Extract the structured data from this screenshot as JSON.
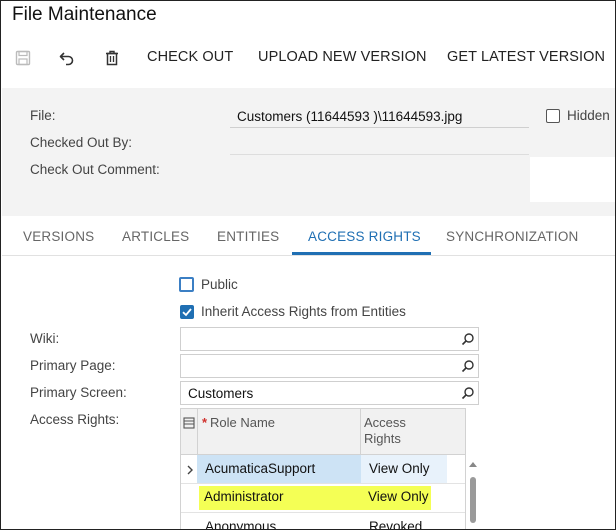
{
  "window": {
    "title": "File Maintenance"
  },
  "toolbar": {
    "save_icon": "save-icon",
    "undo_icon": "undo-icon",
    "delete_icon": "trash-icon",
    "check_out": "CHECK OUT",
    "upload_new_version": "UPLOAD NEW VERSION",
    "get_latest_version": "GET LATEST VERSION"
  },
  "form": {
    "file_label": "File:",
    "file_value": "Customers (11644593  )\\11644593.jpg",
    "hidden_label": "Hidden",
    "hidden_checked": false,
    "checked_out_by_label": "Checked Out By:",
    "checked_out_by_value": "",
    "check_out_comment_label": "Check Out Comment:",
    "check_out_comment_value": ""
  },
  "tabs": [
    {
      "label": "VERSIONS",
      "active": false
    },
    {
      "label": "ARTICLES",
      "active": false
    },
    {
      "label": "ENTITIES",
      "active": false
    },
    {
      "label": "ACCESS RIGHTS",
      "active": true
    },
    {
      "label": "SYNCHRONIZATION",
      "active": false
    }
  ],
  "access": {
    "public_label": "Public",
    "public_checked": false,
    "inherit_label": "Inherit Access Rights from Entities",
    "inherit_checked": true,
    "wiki_label": "Wiki:",
    "wiki_value": "",
    "primary_page_label": "Primary Page:",
    "primary_page_value": "",
    "primary_screen_label": "Primary Screen:",
    "primary_screen_value": "Customers",
    "access_rights_label": "Access Rights:"
  },
  "grid": {
    "columns": {
      "required_mark": "*",
      "role_name": "Role Name",
      "access_rights_1": "Access",
      "access_rights_2": "Rights"
    },
    "rows": [
      {
        "role": "AcumaticaSupport",
        "rights": "View Only",
        "selected": true
      },
      {
        "role": "Administrator",
        "rights": "View Only",
        "highlighted": true
      },
      {
        "role": "Anonymous",
        "rights": "Revoked"
      }
    ]
  },
  "colors": {
    "accent": "#1f6fb3",
    "highlight": "#f4ff55",
    "selected_row": "#cde3f5"
  }
}
